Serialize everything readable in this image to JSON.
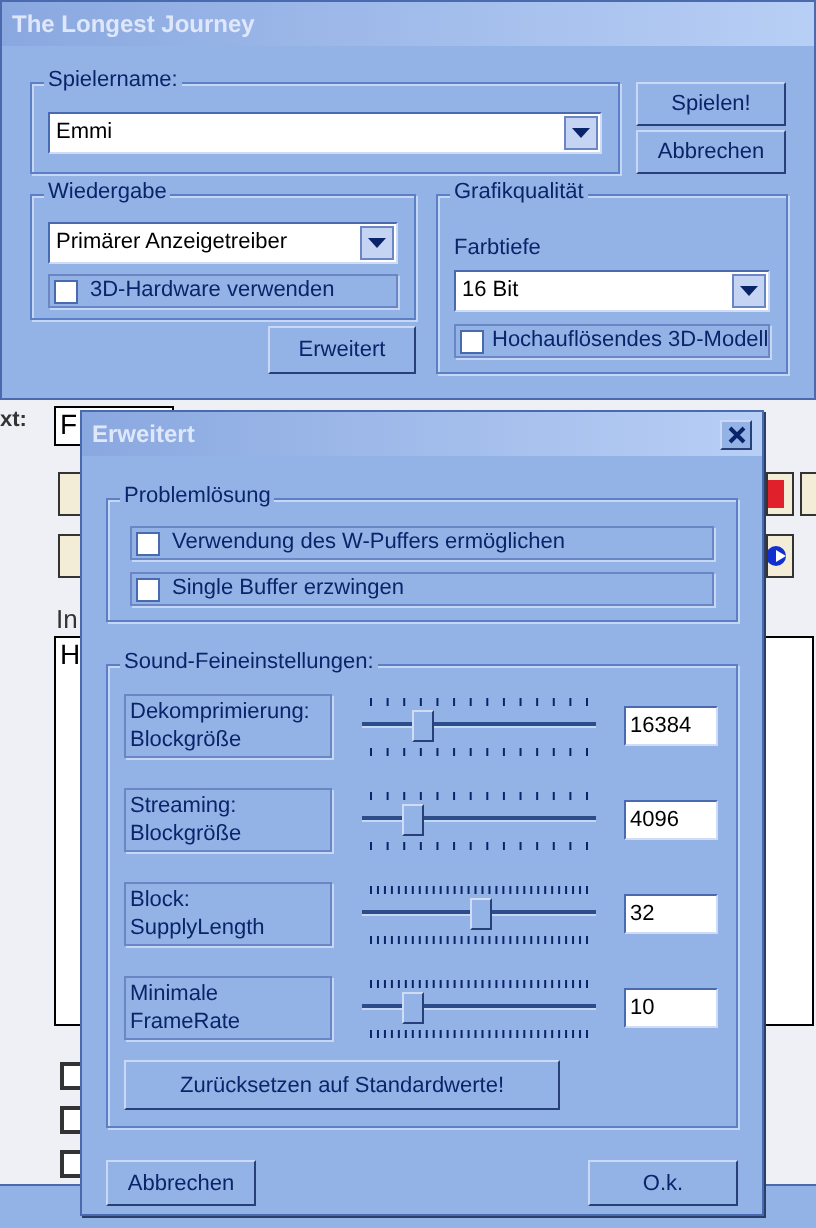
{
  "main_window": {
    "title": "The Longest Journey",
    "player_name": {
      "label": "Spielername:",
      "value": "Emmi"
    },
    "buttons": [
      "Spielen!",
      "Abbrechen"
    ],
    "playback": {
      "label": "Wiedergabe",
      "driver": "Primärer Anzeigetreiber",
      "hardware_3d": {
        "label": "3D-Hardware verwenden",
        "checked": false
      }
    },
    "advanced_button": "Erweitert",
    "graphics": {
      "label": "Grafikqualität",
      "depth_label": "Farbtiefe",
      "depth": "16 Bit",
      "hires": {
        "label": "Hochauflösendes 3D-Modell",
        "checked": false
      }
    }
  },
  "background": {
    "field_label": "xt:",
    "field_value": "F",
    "section_label": "In",
    "text_value": "H",
    "checkboxes": [
      {
        "checked": false
      },
      {
        "checked": false
      },
      {
        "checked": false
      }
    ]
  },
  "advanced_dialog": {
    "title": "Erweitert",
    "troubleshooting": {
      "label": "Problemlösung",
      "options": [
        {
          "label": "Verwendung des W-Puffers ermöglichen",
          "checked": false
        },
        {
          "label": "Single Buffer erzwingen",
          "checked": false
        }
      ]
    },
    "sound": {
      "label": "Sound-Feineinstellungen:",
      "sliders": [
        {
          "label": [
            "Dekomprimierung:",
            "Blockgröße"
          ],
          "level": 0.26,
          "value": "16384"
        },
        {
          "label": [
            "Streaming:",
            "Blockgröße"
          ],
          "level": 0.21,
          "value": "4096"
        },
        {
          "label": [
            "Block:",
            "SupplyLength"
          ],
          "level": 0.5,
          "value": "32"
        },
        {
          "label": [
            "Minimale",
            "FrameRate"
          ],
          "level": 0.21,
          "value": "10"
        }
      ],
      "reset_button": "Zurücksetzen auf Standardwerte!"
    },
    "buttons": [
      "Abbrechen",
      "O.k."
    ]
  }
}
